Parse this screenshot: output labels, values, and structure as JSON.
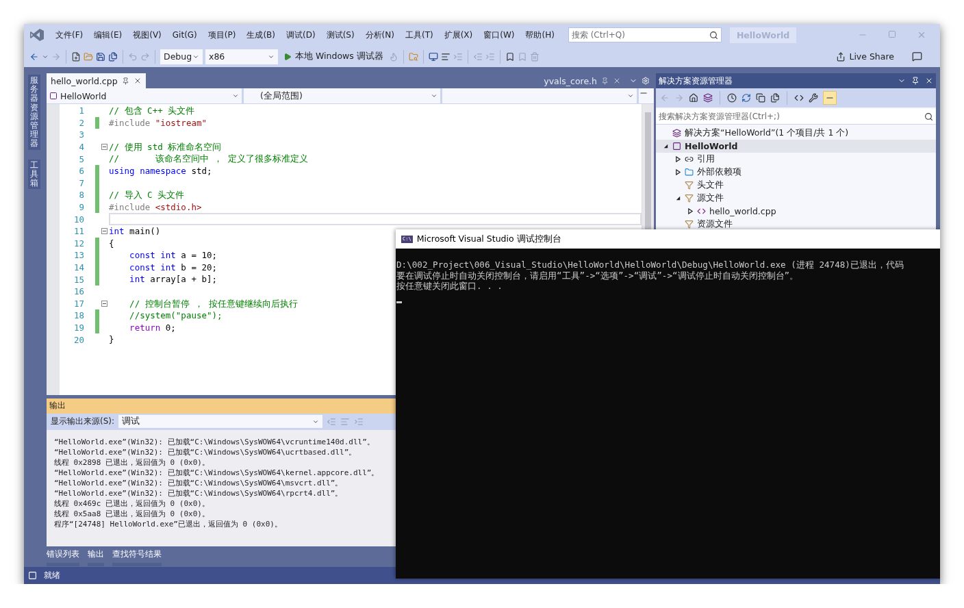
{
  "menu": {
    "items": [
      "文件(F)",
      "编辑(E)",
      "视图(V)",
      "Git(G)",
      "项目(P)",
      "生成(B)",
      "调试(D)",
      "测试(S)",
      "分析(N)",
      "工具(T)",
      "扩展(X)",
      "窗口(W)",
      "帮助(H)"
    ],
    "search_placeholder": "搜索 (Ctrl+Q)",
    "solution_name": "HelloWorld"
  },
  "toolbar": {
    "configuration": "Debug",
    "platform": "x86",
    "start_label": "本地 Windows 调试器",
    "live_share": "Live Share"
  },
  "side_tabs": [
    "服务器资源管理器",
    "工具箱"
  ],
  "editor": {
    "tabs": [
      {
        "label": "hello_world.cpp",
        "selected": true
      },
      {
        "label": "yvals_core.h",
        "selected": false
      }
    ],
    "nav": {
      "project": "HelloWorld",
      "scope": "(全局范围)"
    },
    "lines": [
      {
        "number": "1",
        "changed": false,
        "fold": false,
        "current": false,
        "tokens": [
          {
            "kind": "comment",
            "text": "// 包含 C++ 头文件"
          }
        ]
      },
      {
        "number": "2",
        "changed": true,
        "fold": false,
        "current": false,
        "tokens": [
          {
            "kind": "preproc",
            "text": "#include "
          },
          {
            "kind": "string",
            "text": "\"iostream\""
          }
        ]
      },
      {
        "number": "3",
        "changed": false,
        "fold": false,
        "current": false
      },
      {
        "number": "4",
        "changed": false,
        "fold": true,
        "current": false,
        "tokens": [
          {
            "kind": "comment",
            "text": "// 使用 std 标准命名空间"
          }
        ]
      },
      {
        "number": "5",
        "changed": false,
        "fold": false,
        "current": false,
        "tokens": [
          {
            "kind": "comment",
            "text": "//       该命名空间中 ， 定义了很多标准定义"
          }
        ]
      },
      {
        "number": "6",
        "changed": true,
        "fold": false,
        "current": false,
        "tokens": [
          {
            "kind": "keyword",
            "text": "using namespace"
          },
          {
            "kind": "plain",
            "text": " std;"
          }
        ]
      },
      {
        "number": "7",
        "changed": true,
        "fold": false,
        "current": false
      },
      {
        "number": "8",
        "changed": true,
        "fold": false,
        "current": false,
        "tokens": [
          {
            "kind": "comment",
            "text": "// 导入 C 头文件"
          }
        ]
      },
      {
        "number": "9",
        "changed": true,
        "fold": false,
        "current": false,
        "tokens": [
          {
            "kind": "preproc",
            "text": "#include "
          },
          {
            "kind": "string",
            "text": "<stdio.h>"
          }
        ]
      },
      {
        "number": "10",
        "changed": false,
        "fold": false,
        "current": true
      },
      {
        "number": "11",
        "changed": false,
        "fold": true,
        "current": false,
        "tokens": [
          {
            "kind": "keyword",
            "text": "int"
          },
          {
            "kind": "plain",
            "text": " main()"
          }
        ]
      },
      {
        "number": "12",
        "changed": true,
        "fold": false,
        "current": false,
        "tokens": [
          {
            "kind": "plain",
            "text": "{"
          }
        ]
      },
      {
        "number": "13",
        "changed": true,
        "fold": false,
        "current": false,
        "tokens": [
          {
            "kind": "keyword",
            "text": "    const int"
          },
          {
            "kind": "plain",
            "text": " a = 10;"
          }
        ]
      },
      {
        "number": "14",
        "changed": true,
        "fold": false,
        "current": false,
        "tokens": [
          {
            "kind": "keyword",
            "text": "    const int"
          },
          {
            "kind": "plain",
            "text": " b = 20;"
          }
        ]
      },
      {
        "number": "15",
        "changed": true,
        "fold": false,
        "current": false,
        "tokens": [
          {
            "kind": "keyword",
            "text": "    int"
          },
          {
            "kind": "plain",
            "text": " array[a + b];"
          }
        ]
      },
      {
        "number": "16",
        "changed": false,
        "fold": false,
        "current": false
      },
      {
        "number": "17",
        "changed": false,
        "fold": true,
        "current": false,
        "tokens": [
          {
            "kind": "comment",
            "text": "    // 控制台暂停 ， 按任意键继续向后执行"
          }
        ]
      },
      {
        "number": "18",
        "changed": true,
        "fold": false,
        "current": false,
        "tokens": [
          {
            "kind": "comment",
            "text": "    //system(\"pause\");"
          }
        ]
      },
      {
        "number": "19",
        "changed": true,
        "fold": false,
        "current": false,
        "tokens": [
          {
            "kind": "control",
            "text": "    return"
          },
          {
            "kind": "plain",
            "text": " 0;"
          }
        ]
      },
      {
        "number": "20",
        "changed": false,
        "fold": false,
        "current": false,
        "tokens": [
          {
            "kind": "plain",
            "text": "}"
          }
        ]
      }
    ]
  },
  "solution_explorer": {
    "title": "解决方案资源管理器",
    "search_placeholder": "搜索解决方案资源管理器(Ctrl+;)",
    "tree": [
      {
        "kind": "solution",
        "label": "解决方案“HelloWorld”(1 个项目/共 1 个)"
      },
      {
        "kind": "project",
        "label": "HelloWorld",
        "expanded": true,
        "selected": true,
        "children": [
          {
            "kind": "references",
            "label": "引用",
            "expanded": false,
            "selected": false
          },
          {
            "kind": "external",
            "label": "外部依赖项",
            "expanded": false,
            "selected": false
          },
          {
            "kind": "filter",
            "label": "头文件",
            "selected": false
          },
          {
            "kind": "filter",
            "label": "源文件",
            "expanded": true,
            "selected": false,
            "children": [
              {
                "kind": "cpp",
                "label": "hello_world.cpp",
                "expanded": false,
                "selected": false
              }
            ]
          },
          {
            "kind": "filter",
            "label": "资源文件",
            "selected": false
          }
        ]
      }
    ]
  },
  "output": {
    "title": "输出",
    "source_label": "显示输出来源(S):",
    "source": "调试",
    "lines": [
      "“HelloWorld.exe”(Win32): 已加载“C:\\Windows\\SysWOW64\\vcruntime140d.dll”。",
      "“HelloWorld.exe”(Win32): 已加载“C:\\Windows\\SysWOW64\\ucrtbased.dll”。",
      "线程 0x2898 已退出，返回值为 0 (0x0)。",
      "“HelloWorld.exe”(Win32): 已加载“C:\\Windows\\SysWOW64\\kernel.appcore.dll”。",
      "“HelloWorld.exe”(Win32): 已加载“C:\\Windows\\SysWOW64\\msvcrt.dll”。",
      "“HelloWorld.exe”(Win32): 已加载“C:\\Windows\\SysWOW64\\rpcrt4.dll”。",
      "线程 0x469c 已退出，返回值为 0 (0x0)。",
      "线程 0x5aa8 已退出，返回值为 0 (0x0)。",
      "程序“[24748] HelloWorld.exe”已退出，返回值为 0 (0x0)。"
    ]
  },
  "bottom_tabs": [
    "错误列表",
    "输出",
    "查找符号结果"
  ],
  "status_bar": {
    "text": "就绪"
  },
  "console": {
    "title": "Microsoft Visual Studio 调试控制台",
    "badge": "C:\\",
    "lines": [
      "D:\\002_Project\\006_Visual_Studio\\HelloWorld\\HelloWorld\\Debug\\HelloWorld.exe (进程 24748)已退出，代码",
      "要在调试停止时自动关闭控制台，请启用“工具”->“选项”->“调试”->“调试停止时自动关闭控制台”。",
      "按任意键关闭此窗口. . ."
    ]
  }
}
